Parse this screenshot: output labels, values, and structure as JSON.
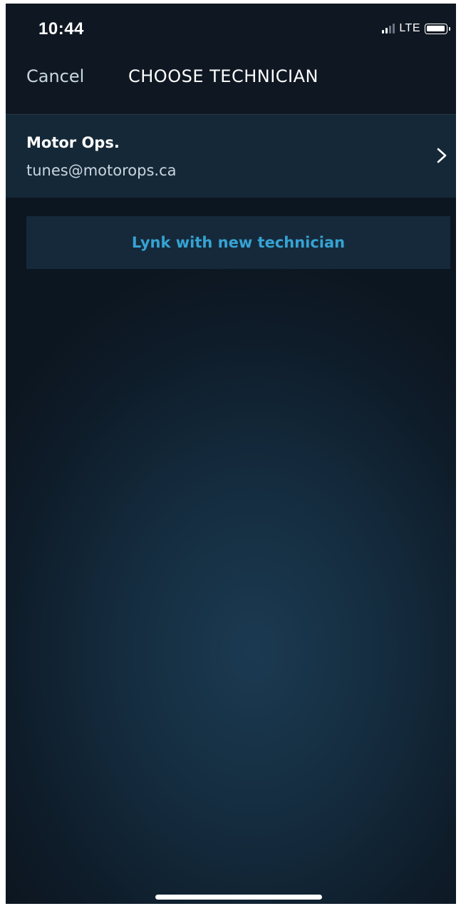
{
  "status_bar": {
    "time": "10:44",
    "network": "LTE",
    "signal_bars_filled": 2,
    "signal_bars_total": 4,
    "battery_level": 0.85
  },
  "nav": {
    "cancel_label": "Cancel",
    "title": "CHOOSE TECHNICIAN"
  },
  "technicians": [
    {
      "name": "Motor Ops.",
      "email": "tunes@motorops.ca",
      "icon": "chevron-right-icon"
    }
  ],
  "actions": {
    "lynk_label": "Lynk with new technician"
  },
  "colors": {
    "background": "#0e1b28",
    "accent": "#35a3d3",
    "row_background": "#152837",
    "secondary_text": "#c9d6e0"
  }
}
